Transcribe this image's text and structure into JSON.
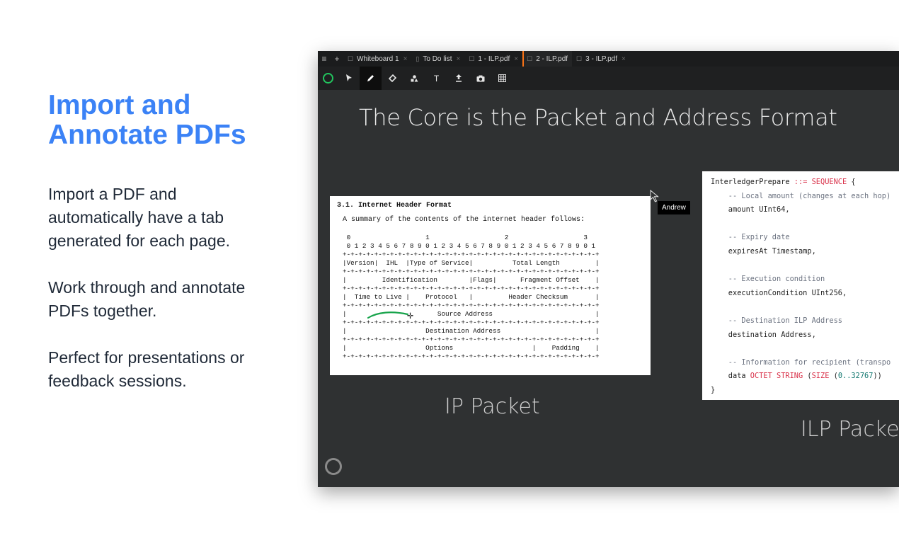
{
  "marketing": {
    "title": "Import and Annotate PDFs",
    "p1": "Import a PDF and automatically have a tab generated for each page.",
    "p2": "Work through and annotate PDFs together.",
    "p3": "Perfect for presentations or feedback sessions."
  },
  "tabbar": {
    "menu_icon": "hamburger-icon",
    "add_icon": "plus-icon",
    "tabs": [
      {
        "label": "Whiteboard 1",
        "icon": "whiteboard-icon"
      },
      {
        "label": "To Do list",
        "icon": "document-icon"
      },
      {
        "label": "1 - ILP.pdf",
        "icon": "whiteboard-icon"
      },
      {
        "label": "2 - ILP.pdf",
        "icon": "whiteboard-icon",
        "active": true
      },
      {
        "label": "3 - ILP.pdf",
        "icon": "whiteboard-icon"
      }
    ]
  },
  "toolbar": {
    "tools": [
      "status-ring",
      "select-arrow",
      "pen",
      "eraser",
      "shapes",
      "text",
      "upload",
      "camera",
      "grid"
    ],
    "active": "pen",
    "accent": "#22c55e"
  },
  "slide": {
    "title": "The Core is the Packet and Address Format",
    "ip_caption": "IP Packet",
    "ilp_caption": "ILP Packet"
  },
  "ip_header": {
    "heading": "3.1.  Internet Header Format",
    "summary": "A summary of the contents of the internet header follows:",
    "diagram": [
      " 0                   1                   2                   3",
      " 0 1 2 3 4 5 6 7 8 9 0 1 2 3 4 5 6 7 8 9 0 1 2 3 4 5 6 7 8 9 0 1",
      "+-+-+-+-+-+-+-+-+-+-+-+-+-+-+-+-+-+-+-+-+-+-+-+-+-+-+-+-+-+-+-+-+",
      "|Version|  IHL  |Type of Service|          Total Length         |",
      "+-+-+-+-+-+-+-+-+-+-+-+-+-+-+-+-+-+-+-+-+-+-+-+-+-+-+-+-+-+-+-+-+",
      "|         Identification        |Flags|      Fragment Offset    |",
      "+-+-+-+-+-+-+-+-+-+-+-+-+-+-+-+-+-+-+-+-+-+-+-+-+-+-+-+-+-+-+-+-+",
      "|  Time to Live |    Protocol   |         Header Checksum       |",
      "+-+-+-+-+-+-+-+-+-+-+-+-+-+-+-+-+-+-+-+-+-+-+-+-+-+-+-+-+-+-+-+-+",
      "|                       Source Address                          |",
      "+-+-+-+-+-+-+-+-+-+-+-+-+-+-+-+-+-+-+-+-+-+-+-+-+-+-+-+-+-+-+-+-+",
      "|                    Destination Address                        |",
      "+-+-+-+-+-+-+-+-+-+-+-+-+-+-+-+-+-+-+-+-+-+-+-+-+-+-+-+-+-+-+-+-+",
      "|                    Options                    |    Padding    |",
      "+-+-+-+-+-+-+-+-+-+-+-+-+-+-+-+-+-+-+-+-+-+-+-+-+-+-+-+-+-+-+-+-+"
    ],
    "annotation_color": "#16a34a"
  },
  "cursor": {
    "label": "Andrew"
  },
  "ilp_code": {
    "line1_a": "InterledgerPrepare ",
    "line1_op": "::=",
    "line1_kw": " SEQUENCE",
    "line1_b": " {",
    "c1": "    -- Local amount (changes at each hop)",
    "l1": "    amount UInt64,",
    "c2": "    -- Expiry date",
    "l2": "    expiresAt Timestamp,",
    "c3": "    -- Execution condition",
    "l3": "    executionCondition UInt256,",
    "c4": "    -- Destination ILP Address",
    "l4": "    destination Address,",
    "c5": "    -- Information for recipient (transpo",
    "l5_a": "    data ",
    "l5_kw1": "OCTET STRING",
    "l5_b": " (",
    "l5_kw2": "SIZE",
    "l5_c": " (",
    "l5_n": "0..32767",
    "l5_d": "))",
    "close": "}"
  }
}
